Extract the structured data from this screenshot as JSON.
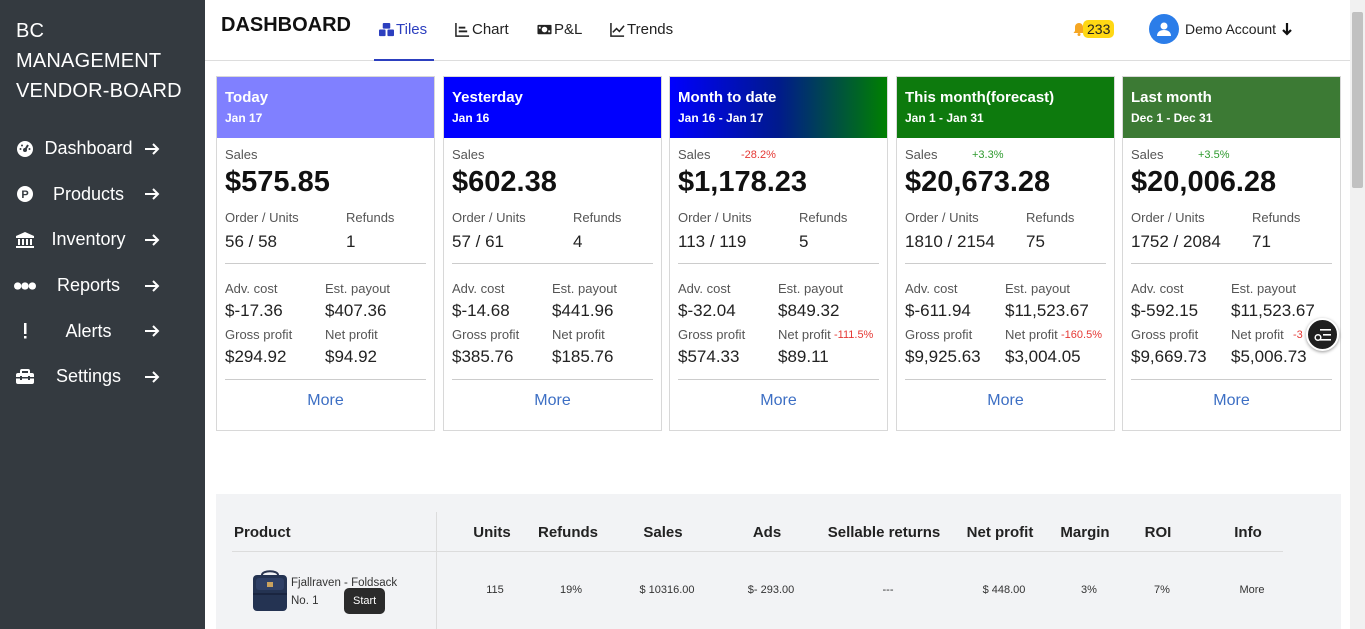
{
  "sidebar": {
    "brand": [
      "BC",
      "MANAGEMENT",
      "VENDOR-BOARD"
    ],
    "items": [
      {
        "label": "Dashboard",
        "icon": "dashboard-gauge-icon"
      },
      {
        "label": "Products",
        "icon": "product-p-icon"
      },
      {
        "label": "Inventory",
        "icon": "bank-icon"
      },
      {
        "label": "Reports",
        "icon": "dots-icon"
      },
      {
        "label": "Alerts",
        "icon": "exclamation-icon"
      },
      {
        "label": "Settings",
        "icon": "toolbox-icon"
      }
    ]
  },
  "header": {
    "title": "DASHBOARD",
    "tabs": [
      {
        "label": "Tiles",
        "icon": "tiles-icon",
        "active": true
      },
      {
        "label": "Chart",
        "icon": "chart-icon",
        "active": false
      },
      {
        "label": "P&L",
        "icon": "money-icon",
        "active": false
      },
      {
        "label": "Trends",
        "icon": "trend-icon",
        "active": false
      }
    ],
    "notifications": "233",
    "account": "Demo Account"
  },
  "colors": {
    "accent": "#2c3fbf",
    "sidebar": "#343a40",
    "badge": "#ffd814",
    "link": "#3d6fc4"
  },
  "labels": {
    "sales": "Sales",
    "orders": "Order / Units",
    "refunds": "Refunds",
    "adv_cost": "Adv. cost",
    "payout": "Est. payout",
    "gross": "Gross profit",
    "net": "Net profit",
    "more": "More"
  },
  "cards": [
    {
      "title": "Today",
      "date": "Jan 17",
      "sales": "$575.85",
      "sales_change": "",
      "orders": "56 / 58",
      "refunds": "1",
      "adv_cost": "$-17.36",
      "payout": "$407.36",
      "gross": "$294.92",
      "net": "$94.92",
      "net_change": ""
    },
    {
      "title": "Yesterday",
      "date": "Jan 16",
      "sales": "$602.38",
      "sales_change": "",
      "orders": "57 / 61",
      "refunds": "4",
      "adv_cost": "$-14.68",
      "payout": "$441.96",
      "gross": "$385.76",
      "net": "$185.76",
      "net_change": ""
    },
    {
      "title": "Month to date",
      "date": "Jan 16 - Jan 17",
      "sales": "$1,178.23",
      "sales_change": "-28.2%",
      "orders": "113 / 119",
      "refunds": "5",
      "adv_cost": "$-32.04",
      "payout": "$849.32",
      "gross": "$574.33",
      "net": "$89.11",
      "net_change": "-111.5%"
    },
    {
      "title": "This month(forecast)",
      "date": "Jan 1 - Jan 31",
      "sales": "$20,673.28",
      "sales_change": "+3.3%",
      "orders": "1810 / 2154",
      "refunds": "75",
      "adv_cost": "$-611.94",
      "payout": "$11,523.67",
      "gross": "$9,925.63",
      "net": "$3,004.05",
      "net_change": "-160.5%"
    },
    {
      "title": "Last month",
      "date": "Dec 1 - Dec 31",
      "sales": "$20,006.28",
      "sales_change": "+3.5%",
      "orders": "1752 / 2084",
      "refunds": "71",
      "adv_cost": "$-592.15",
      "payout": "$11,523.67",
      "gross": "$9,669.73",
      "net": "$5,006.73",
      "net_change": "-3"
    }
  ],
  "table": {
    "headers": [
      "Product",
      "Units",
      "Refunds",
      "Sales",
      "Ads",
      "Sellable returns",
      "Net profit",
      "Margin",
      "ROI",
      "Info"
    ],
    "rows": [
      {
        "product": "Fjallraven - Foldsack No. 1",
        "units": "115",
        "refunds": "19%",
        "sales": "$ 10316.00",
        "ads": "$- 293.00",
        "returns": "---",
        "net": "$ 448.00",
        "margin": "3%",
        "roi": "7%",
        "info": "More"
      }
    ]
  },
  "tooltip": "Start"
}
